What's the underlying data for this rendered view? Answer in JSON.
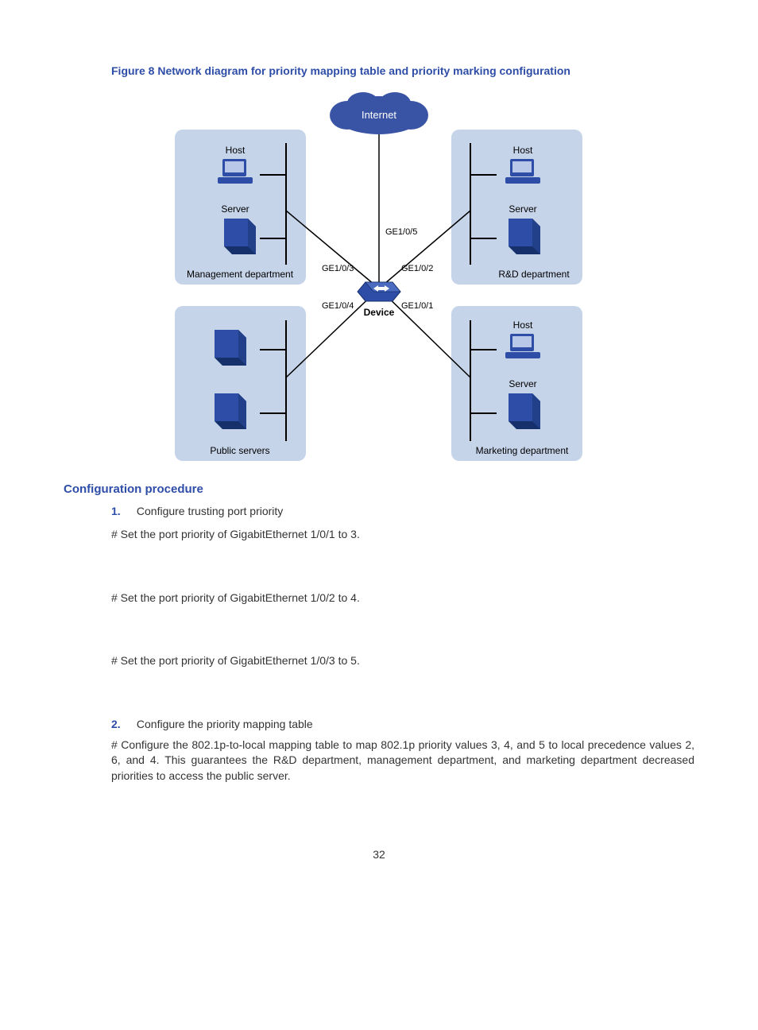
{
  "figure": {
    "caption": "Figure 8 Network diagram for priority mapping table and priority marking configuration",
    "internet": "Internet",
    "device": "Device",
    "labels": {
      "host": "Host",
      "server": "Server",
      "mgmt": "Management department",
      "rnd": "R&D department",
      "pub": "Public servers",
      "mkt": "Marketing department"
    },
    "ports": {
      "ge105": "GE1/0/5",
      "ge103": "GE1/0/3",
      "ge102": "GE1/0/2",
      "ge104": "GE1/0/4",
      "ge101": "GE1/0/1"
    }
  },
  "section": {
    "title": "Configuration procedure",
    "step1_num": "1.",
    "step1_text": "Configure trusting port priority",
    "hash1": "# Set the port priority of GigabitEthernet 1/0/1 to 3.",
    "hash2": "# Set the port priority of GigabitEthernet 1/0/2 to 4.",
    "hash3": "# Set the port priority of GigabitEthernet 1/0/3 to 5.",
    "step2_num": "2.",
    "step2_text": "Configure the priority mapping table",
    "para": "# Configure the 802.1p-to-local mapping table to map 802.1p priority values 3, 4, and 5 to local precedence values 2, 6, and 4. This guarantees the R&D department, management department, and marketing department decreased priorities to access the public server."
  },
  "page": "32"
}
